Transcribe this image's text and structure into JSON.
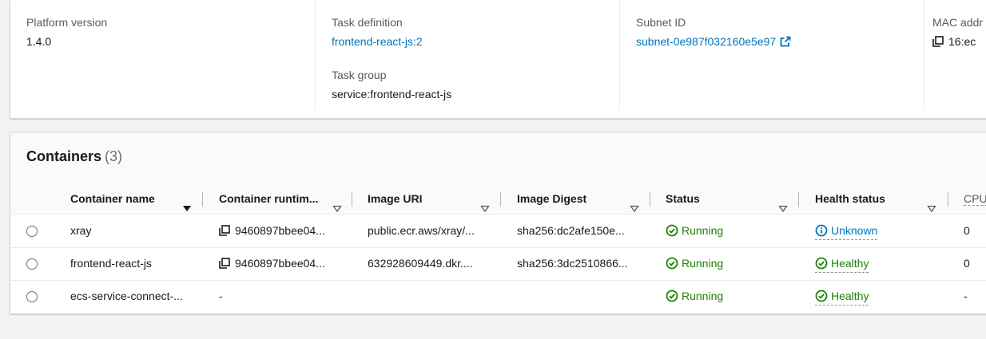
{
  "details": {
    "platform_version": {
      "label": "Platform version",
      "value": "1.4.0"
    },
    "task_definition": {
      "label": "Task definition",
      "value": "frontend-react-js:2"
    },
    "task_group": {
      "label": "Task group",
      "value": "service:frontend-react-js"
    },
    "subnet_id": {
      "label": "Subnet ID",
      "value": "subnet-0e987f032160e5e97"
    },
    "mac_address": {
      "label": "MAC addr",
      "value": "16:ec"
    }
  },
  "containers": {
    "title": "Containers",
    "count": "(3)",
    "columns": [
      {
        "label": "Container name",
        "sort_icon": "caret-down-filled-icon"
      },
      {
        "label": "Container runtim...",
        "sort_icon": "caret-down-outline-icon"
      },
      {
        "label": "Image URI",
        "sort_icon": "caret-down-outline-icon"
      },
      {
        "label": "Image Digest",
        "sort_icon": "caret-down-outline-icon"
      },
      {
        "label": "Status",
        "sort_icon": "caret-down-outline-icon"
      },
      {
        "label": "Health status",
        "sort_icon": "caret-down-outline-icon"
      },
      {
        "label": "CPU",
        "sort_icon": ""
      }
    ],
    "rows": [
      {
        "name": "xray",
        "runtime_id": "9460897bbee04...",
        "image_uri": "public.ecr.aws/xray/...",
        "image_digest": "sha256:dc2afe150e...",
        "status": "Running",
        "health": "Unknown",
        "cpu": "0"
      },
      {
        "name": "frontend-react-js",
        "runtime_id": "9460897bbee04...",
        "image_uri": "632928609449.dkr....",
        "image_digest": "sha256:3dc2510866...",
        "status": "Running",
        "health": "Healthy",
        "cpu": "0"
      },
      {
        "name": "ecs-service-connect-...",
        "runtime_id": "-",
        "image_uri": "",
        "image_digest": "",
        "status": "Running",
        "health": "Healthy",
        "cpu": "-"
      }
    ]
  },
  "colors": {
    "link": "#0073bb",
    "success": "#1d8102",
    "text": "#16191f",
    "label": "#545b64",
    "background": "#f2f3f3"
  },
  "icons": {
    "external_link": "external-link-icon",
    "copy": "copy-icon",
    "status_running": "check-circle-icon",
    "health_unknown": "info-circle-icon",
    "health_healthy": "check-circle-icon"
  }
}
